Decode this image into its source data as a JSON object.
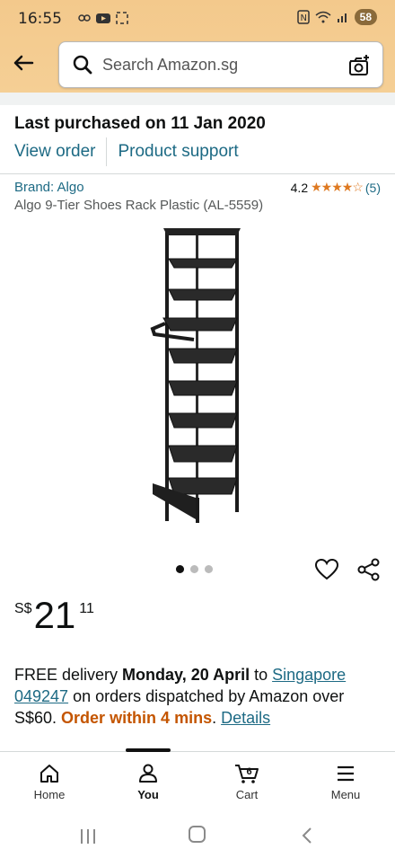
{
  "status_bar": {
    "time": "16:55",
    "battery": "58"
  },
  "search": {
    "placeholder": "Search Amazon.sg"
  },
  "order": {
    "last_purchased": "Last purchased on 11 Jan 2020",
    "view_order": "View order",
    "product_support": "Product support"
  },
  "product": {
    "brand": "Brand: Algo",
    "rating_value": "4.2",
    "rating_stars": 4.2,
    "rating_count": "(5)",
    "title": "Algo 9-Tier Shoes Rack Plastic (AL-5559)",
    "image_count": 3,
    "image_index": 1
  },
  "price": {
    "currency": "S$",
    "whole": "21",
    "fraction": "11"
  },
  "delivery": {
    "prefix": "FREE delivery ",
    "date": "Monday, 20 April",
    "to": " to ",
    "location": "Singapore 049247",
    "middle": " on orders dispatched by Amazon over S$60. ",
    "urgency": "Order within 4 mins",
    "period": ". ",
    "details": "Details"
  },
  "bottom_nav": {
    "home": "Home",
    "you": "You",
    "cart": "Cart",
    "cart_count": "6",
    "menu": "Menu"
  },
  "colors": {
    "header": "#f3c98c",
    "link": "#1d6a84",
    "star": "#de7921",
    "urgent": "#c45500"
  }
}
